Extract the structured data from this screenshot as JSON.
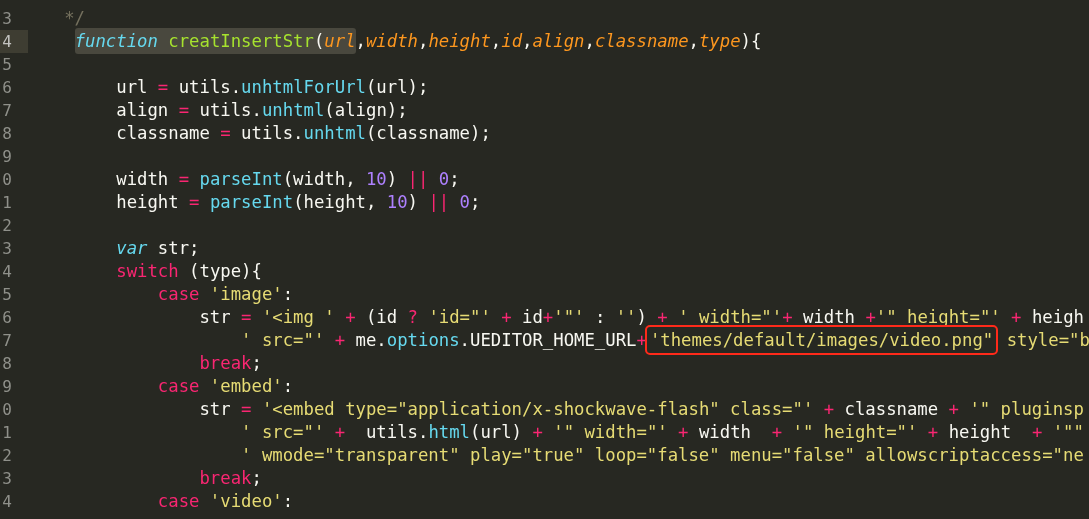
{
  "editor": {
    "lines": [
      {
        "number": "3",
        "current": false,
        "tokens": [
          {
            "kind": "comment",
            "text": "   */"
          }
        ]
      },
      {
        "number": "4",
        "current": true,
        "tokens": [
          {
            "kind": "highlight",
            "tokens": [
              {
                "kind": "storage",
                "text": "    function"
              },
              {
                "kind": "function",
                "text": " creatInsertStr"
              },
              {
                "kind": "plain",
                "text": "("
              },
              {
                "kind": "param",
                "text": "url"
              }
            ]
          },
          {
            "kind": "plain",
            "text": ","
          },
          {
            "kind": "param",
            "text": "width"
          },
          {
            "kind": "plain",
            "text": ","
          },
          {
            "kind": "param",
            "text": "height"
          },
          {
            "kind": "plain",
            "text": ","
          },
          {
            "kind": "param",
            "text": "id"
          },
          {
            "kind": "plain",
            "text": ","
          },
          {
            "kind": "param",
            "text": "align"
          },
          {
            "kind": "plain",
            "text": ","
          },
          {
            "kind": "param",
            "text": "classname"
          },
          {
            "kind": "plain",
            "text": ","
          },
          {
            "kind": "param",
            "text": "type"
          },
          {
            "kind": "plain",
            "text": "){"
          }
        ]
      },
      {
        "number": "5",
        "current": false
      },
      {
        "number": "6",
        "current": false,
        "tokens": [
          {
            "kind": "plain",
            "text": "        url "
          },
          {
            "kind": "operator",
            "text": "="
          },
          {
            "kind": "plain",
            "text": " utils."
          },
          {
            "kind": "call",
            "text": "unhtmlForUrl"
          },
          {
            "kind": "plain",
            "text": "(url);"
          }
        ]
      },
      {
        "number": "7",
        "current": false,
        "tokens": [
          {
            "kind": "plain",
            "text": "        align "
          },
          {
            "kind": "operator",
            "text": "="
          },
          {
            "kind": "plain",
            "text": " utils."
          },
          {
            "kind": "call",
            "text": "unhtml"
          },
          {
            "kind": "plain",
            "text": "(align);"
          }
        ]
      },
      {
        "number": "8",
        "current": false,
        "tokens": [
          {
            "kind": "plain",
            "text": "        classname "
          },
          {
            "kind": "operator",
            "text": "="
          },
          {
            "kind": "plain",
            "text": " utils."
          },
          {
            "kind": "call",
            "text": "unhtml"
          },
          {
            "kind": "plain",
            "text": "(classname);"
          }
        ]
      },
      {
        "number": "9",
        "current": false
      },
      {
        "number": "0",
        "current": false,
        "tokens": [
          {
            "kind": "plain",
            "text": "        width "
          },
          {
            "kind": "operator",
            "text": "="
          },
          {
            "kind": "call",
            "text": " parseInt"
          },
          {
            "kind": "plain",
            "text": "(width, "
          },
          {
            "kind": "number",
            "text": "10"
          },
          {
            "kind": "plain",
            "text": ") "
          },
          {
            "kind": "operator",
            "text": "||"
          },
          {
            "kind": "number",
            "text": " 0"
          },
          {
            "kind": "plain",
            "text": ";"
          }
        ]
      },
      {
        "number": "1",
        "current": false,
        "tokens": [
          {
            "kind": "plain",
            "text": "        height "
          },
          {
            "kind": "operator",
            "text": "="
          },
          {
            "kind": "call",
            "text": " parseInt"
          },
          {
            "kind": "plain",
            "text": "(height, "
          },
          {
            "kind": "number",
            "text": "10"
          },
          {
            "kind": "plain",
            "text": ") "
          },
          {
            "kind": "operator",
            "text": "||"
          },
          {
            "kind": "number",
            "text": " 0"
          },
          {
            "kind": "plain",
            "text": ";"
          }
        ]
      },
      {
        "number": "2",
        "current": false
      },
      {
        "number": "3",
        "current": false,
        "tokens": [
          {
            "kind": "storage",
            "text": "        var"
          },
          {
            "kind": "plain",
            "text": " str;"
          }
        ]
      },
      {
        "number": "4",
        "current": false,
        "tokens": [
          {
            "kind": "keyword",
            "text": "        switch"
          },
          {
            "kind": "plain",
            "text": " (type){"
          }
        ]
      },
      {
        "number": "5",
        "current": false,
        "tokens": [
          {
            "kind": "keyword",
            "text": "            case"
          },
          {
            "kind": "string",
            "text": " 'image'"
          },
          {
            "kind": "plain",
            "text": ":"
          }
        ]
      },
      {
        "number": "6",
        "current": false,
        "tokens": [
          {
            "kind": "plain",
            "text": "                str "
          },
          {
            "kind": "operator",
            "text": "="
          },
          {
            "kind": "string",
            "text": " '<img '"
          },
          {
            "kind": "operator",
            "text": " +"
          },
          {
            "kind": "plain",
            "text": " (id "
          },
          {
            "kind": "operator",
            "text": "?"
          },
          {
            "kind": "string",
            "text": " 'id=\"'"
          },
          {
            "kind": "operator",
            "text": " +"
          },
          {
            "kind": "plain",
            "text": " id"
          },
          {
            "kind": "operator",
            "text": "+"
          },
          {
            "kind": "string",
            "text": "'\"'"
          },
          {
            "kind": "plain",
            "text": " : "
          },
          {
            "kind": "string",
            "text": "''"
          },
          {
            "kind": "plain",
            "text": ") "
          },
          {
            "kind": "operator",
            "text": "+"
          },
          {
            "kind": "string",
            "text": " ' width=\"'"
          },
          {
            "kind": "operator",
            "text": "+"
          },
          {
            "kind": "plain",
            "text": " width "
          },
          {
            "kind": "operator",
            "text": "+"
          },
          {
            "kind": "string",
            "text": "'\" height=\"'"
          },
          {
            "kind": "operator",
            "text": " +"
          },
          {
            "kind": "plain",
            "text": " heigh"
          }
        ]
      },
      {
        "number": "7",
        "current": false,
        "tokens": [
          {
            "kind": "string",
            "text": "                    ' src=\"'"
          },
          {
            "kind": "operator",
            "text": " +"
          },
          {
            "kind": "plain",
            "text": " me."
          },
          {
            "kind": "call",
            "text": "options"
          },
          {
            "kind": "plain",
            "text": ".UEDITOR_HOME_URL"
          },
          {
            "kind": "operator",
            "text": "+"
          },
          {
            "kind": "boxed",
            "tokens": [
              {
                "kind": "string",
                "text": "'themes/default/images/video.png\""
              }
            ]
          },
          {
            "kind": "string",
            "text": " style=\"b"
          }
        ]
      },
      {
        "number": "8",
        "current": false,
        "tokens": [
          {
            "kind": "keyword",
            "text": "                break"
          },
          {
            "kind": "plain",
            "text": ";"
          }
        ]
      },
      {
        "number": "9",
        "current": false,
        "tokens": [
          {
            "kind": "keyword",
            "text": "            case"
          },
          {
            "kind": "string",
            "text": " 'embed'"
          },
          {
            "kind": "plain",
            "text": ":"
          }
        ]
      },
      {
        "number": "0",
        "current": false,
        "tokens": [
          {
            "kind": "plain",
            "text": "                str "
          },
          {
            "kind": "operator",
            "text": "="
          },
          {
            "kind": "string",
            "text": " '<embed type=\"application/x-shockwave-flash\" class=\"'"
          },
          {
            "kind": "operator",
            "text": " +"
          },
          {
            "kind": "plain",
            "text": " classname "
          },
          {
            "kind": "operator",
            "text": "+"
          },
          {
            "kind": "string",
            "text": " '\" pluginsp"
          }
        ]
      },
      {
        "number": "1",
        "current": false,
        "tokens": [
          {
            "kind": "string",
            "text": "                    ' src=\"'"
          },
          {
            "kind": "operator",
            "text": " +"
          },
          {
            "kind": "plain",
            "text": "  utils."
          },
          {
            "kind": "call",
            "text": "html"
          },
          {
            "kind": "plain",
            "text": "(url) "
          },
          {
            "kind": "operator",
            "text": "+"
          },
          {
            "kind": "string",
            "text": " '\" width=\"'"
          },
          {
            "kind": "operator",
            "text": " +"
          },
          {
            "kind": "plain",
            "text": " width  "
          },
          {
            "kind": "operator",
            "text": "+"
          },
          {
            "kind": "string",
            "text": " '\" height=\"'"
          },
          {
            "kind": "operator",
            "text": " +"
          },
          {
            "kind": "plain",
            "text": " height  "
          },
          {
            "kind": "operator",
            "text": "+"
          },
          {
            "kind": "string",
            "text": " '\"\""
          }
        ]
      },
      {
        "number": "2",
        "current": false,
        "tokens": [
          {
            "kind": "string",
            "text": "                    ' wmode=\"transparent\" play=\"true\" loop=\"false\" menu=\"false\" allowscriptaccess=\"ne"
          }
        ]
      },
      {
        "number": "3",
        "current": false,
        "tokens": [
          {
            "kind": "keyword",
            "text": "                break"
          },
          {
            "kind": "plain",
            "text": ";"
          }
        ]
      },
      {
        "number": "4",
        "current": false,
        "tokens": [
          {
            "kind": "keyword",
            "text": "            case"
          },
          {
            "kind": "string",
            "text": " 'video'"
          },
          {
            "kind": "plain",
            "text": ":"
          }
        ]
      }
    ]
  }
}
